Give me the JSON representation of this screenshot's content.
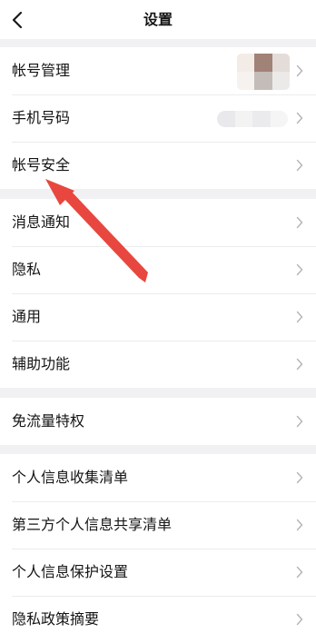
{
  "header": {
    "title": "设置",
    "back_icon": "chevron-left-icon"
  },
  "groups": [
    {
      "items": [
        {
          "label": "帐号管理",
          "trailing": "avatar"
        },
        {
          "label": "手机号码",
          "trailing": "phone-number-blurred"
        },
        {
          "label": "帐号安全"
        }
      ]
    },
    {
      "items": [
        {
          "label": "消息通知"
        },
        {
          "label": "隐私"
        },
        {
          "label": "通用"
        },
        {
          "label": "辅助功能"
        }
      ]
    },
    {
      "items": [
        {
          "label": "免流量特权"
        }
      ]
    },
    {
      "items": [
        {
          "label": "个人信息收集清单"
        },
        {
          "label": "第三方个人信息共享清单"
        },
        {
          "label": "个人信息保护设置"
        },
        {
          "label": "隐私政策摘要"
        }
      ]
    }
  ],
  "annotation": {
    "color": "#e8473f",
    "points_to": "帐号安全"
  },
  "colors": {
    "background": "#f1f1f3",
    "card": "#ffffff",
    "chevron": "#b4b4b8"
  }
}
